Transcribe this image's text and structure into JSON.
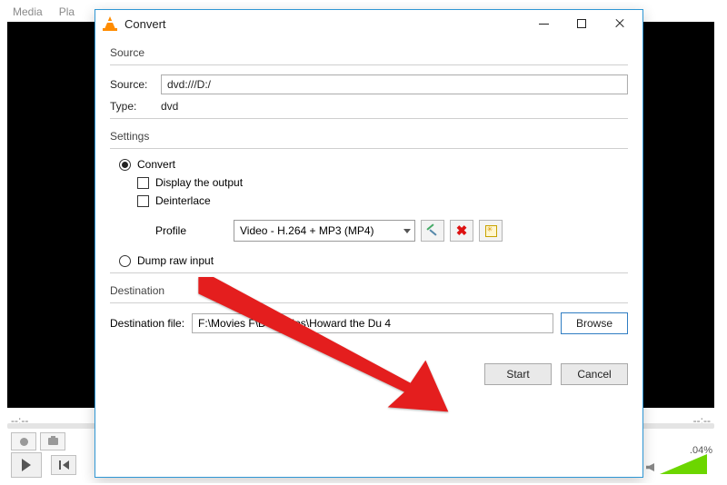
{
  "bg": {
    "menu": [
      "Media",
      "Pla"
    ],
    "time_left": "--:--",
    "time_right": "--:--",
    "volume_text": ".04%"
  },
  "dialog": {
    "title": "Convert",
    "source": {
      "group": "Source",
      "source_label": "Source:",
      "source_value": "dvd:///D:/",
      "type_label": "Type:",
      "type_value": "dvd"
    },
    "settings": {
      "group": "Settings",
      "convert": "Convert",
      "display_output": "Display the output",
      "deinterlace": "Deinterlace",
      "profile_label": "Profile",
      "profile_value": "Video - H.264 + MP3 (MP4)",
      "dump": "Dump raw input"
    },
    "destination": {
      "group": "Destination",
      "label": "Destination file:",
      "value": "F:\\Movies F\\DVD Rips\\Howard the Du      4",
      "browse": "Browse"
    },
    "footer": {
      "start": "Start",
      "cancel": "Cancel"
    }
  }
}
